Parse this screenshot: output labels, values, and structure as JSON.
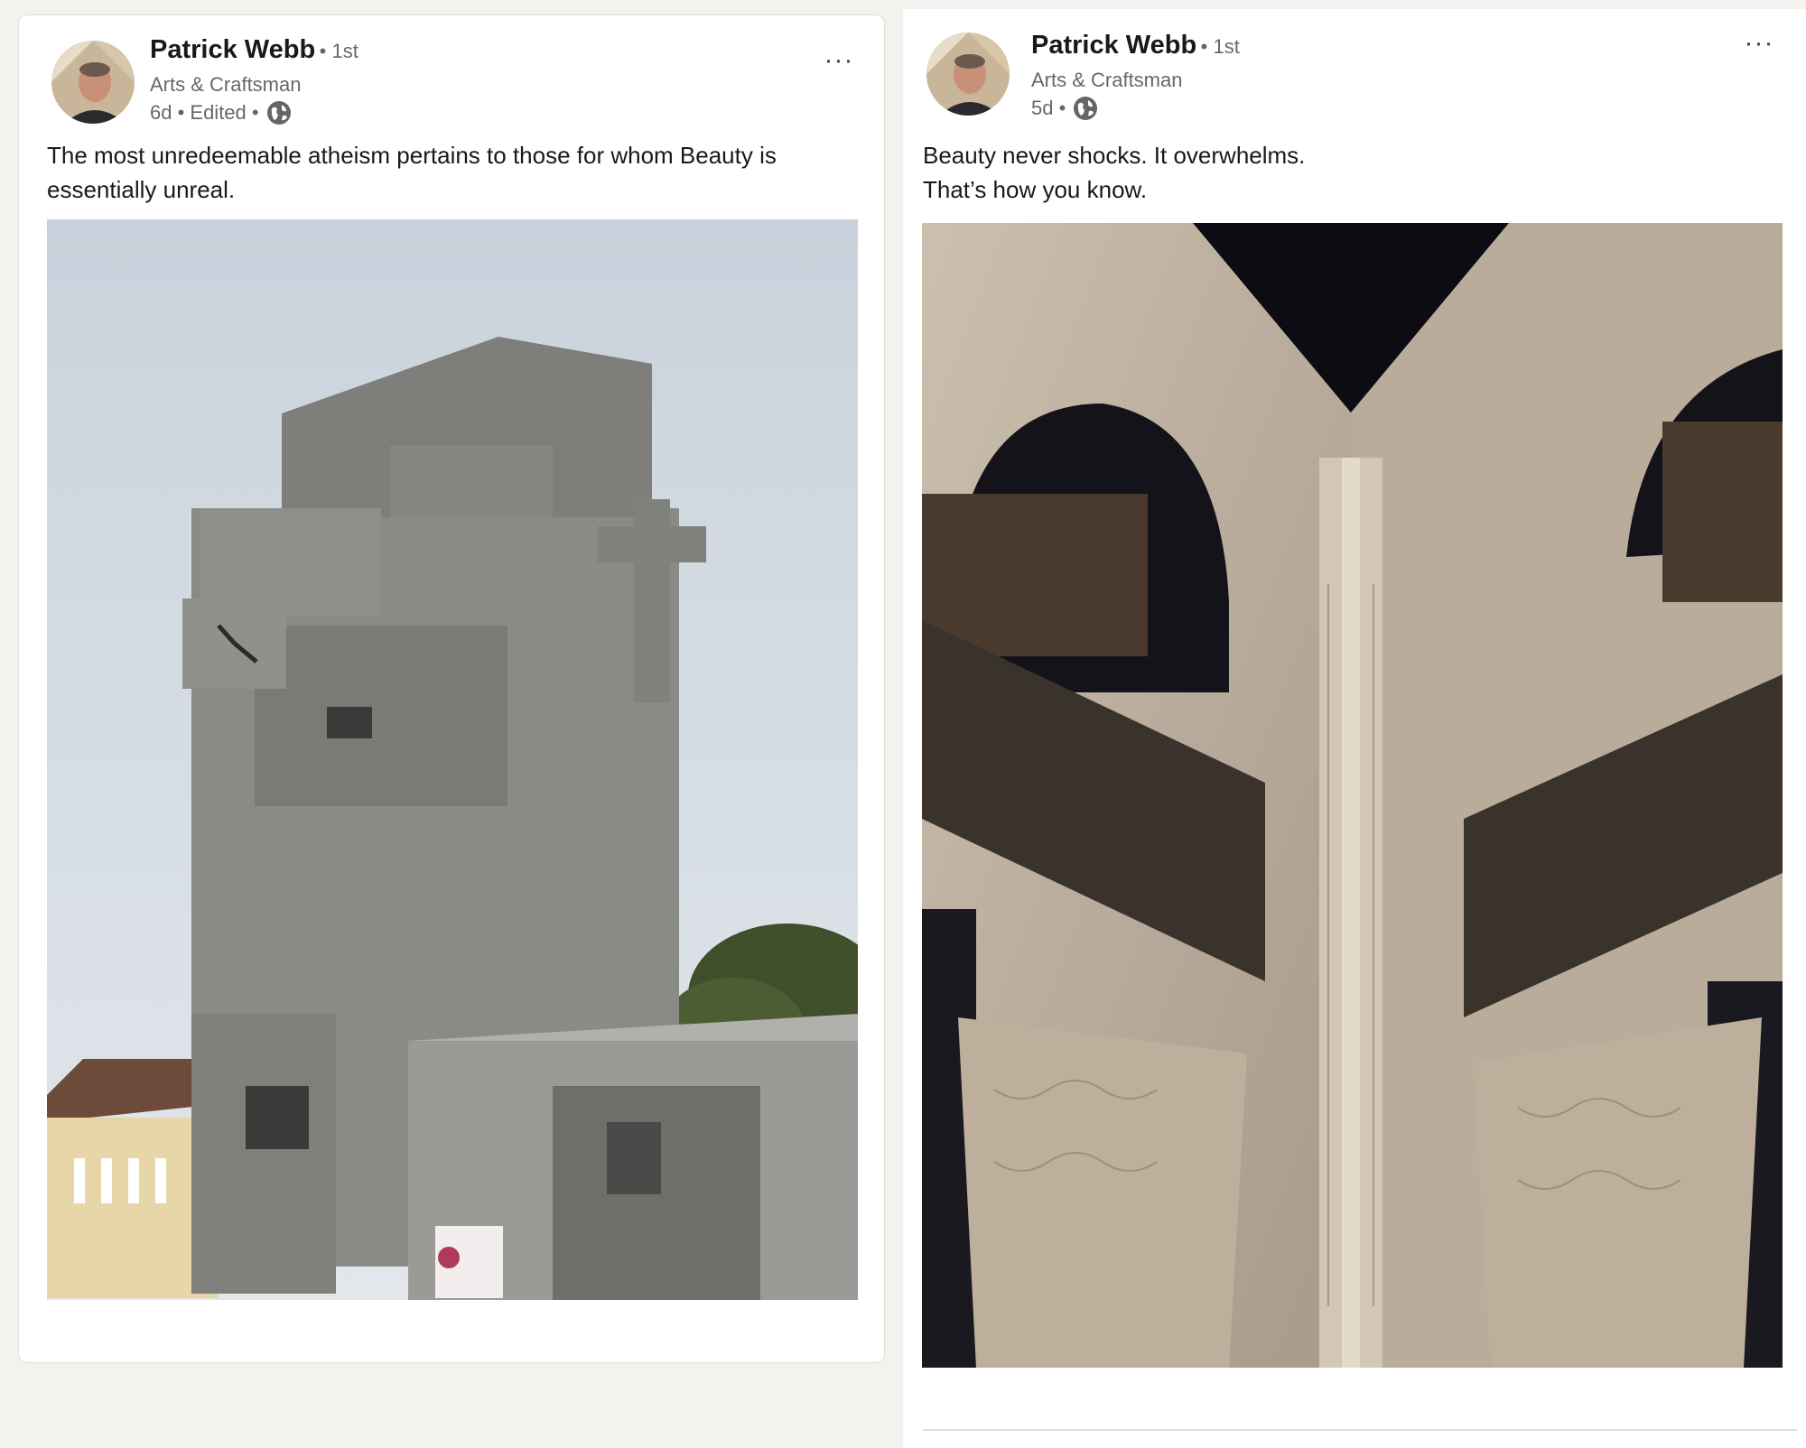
{
  "posts": [
    {
      "author": "Patrick Webb",
      "degree": "• 1st",
      "headline": "Arts & Craftsman",
      "meta": "6d • Edited •",
      "globe_icon": "globe-icon",
      "more_label": "···",
      "text": "The most unredeemable atheism pertains to those for whom Beauty is essentially unreal.",
      "image_subject": "brutalist-concrete-church-tower"
    },
    {
      "author": "Patrick Webb",
      "degree": "• 1st",
      "headline": "Arts & Craftsman",
      "meta": "5d •",
      "globe_icon": "globe-icon",
      "more_label": "···",
      "text_lines": [
        "Beauty never shocks. It overwhelms.",
        "That’s how you know."
      ],
      "image_subject": "ornate-carved-arches-courtyard"
    }
  ],
  "colors": {
    "page_background": "#f4f2ee",
    "card_background": "#ffffff",
    "secondary_text": "#666666"
  }
}
